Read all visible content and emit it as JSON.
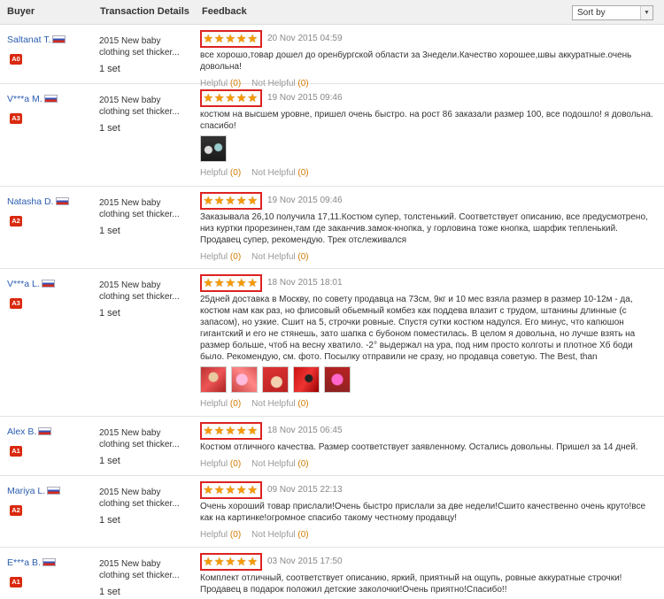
{
  "header": {
    "buyer": "Buyer",
    "transaction": "Transaction Details",
    "feedback": "Feedback",
    "sort_label": "Sort by"
  },
  "helpful_label": "Helpful",
  "not_helpful_label": "Not Helpful",
  "rows": [
    {
      "buyer": "Saltanat T.",
      "level": "A0",
      "product": "2015 New baby clothing set thicker...",
      "qty": "1 set",
      "date": "20 Nov 2015 04:59",
      "text": "все хорошо,товар дошел до оренбургской области за 3недели.Качество хорошее,швы аккуратные.очень довольна!",
      "helpful": "(0)",
      "not_helpful": "(0)",
      "rating": 5
    },
    {
      "buyer": "V***a M.",
      "level": "A3",
      "product": "2015 New baby clothing set thicker...",
      "qty": "1 set",
      "date": "19 Nov 2015 09:46",
      "text": "костюм на высшем уровне, пришел очень быстро. на рост 86 заказали размер 100, все подошло! я довольна. спасибо!",
      "helpful": "(0)",
      "not_helpful": "(0)",
      "rating": 5,
      "photo_count": 1
    },
    {
      "buyer": "Natasha D.",
      "level": "A2",
      "product": "2015 New baby clothing set thicker...",
      "qty": "1 set",
      "date": "19 Nov 2015 09:46",
      "text": "Заказывала 26,10 получила 17,11.Костюм супер, толстенький. Соответствует описанию, все предусмотрено, низ куртки прорезинен,там где заканчив.замок-кнопка, у горловина тоже кнопка, шарфик тепленький. Продавец супер, рекомендую. Трек отслеживался",
      "helpful": "(0)",
      "not_helpful": "(0)",
      "rating": 5
    },
    {
      "buyer": "V***a L.",
      "level": "A3",
      "product": "2015 New baby clothing set thicker...",
      "qty": "1 set",
      "date": "18 Nov 2015 18:01",
      "text": "25дней доставка в Москву, по совету продавца на 73см, 9кг и 10 мес взяла размер в размер 10-12м - да, костюм нам как раз, но флисовый обьемный комбез как поддева влазит с трудом, штанины длинные (с запасом), но узкие. Сшит на 5, строчки ровные. Спустя сутки костюм надулся. Его минус, что капюшон гигантский и его не стянешь, зато шапка с бубоном поместилась. В целом я довольна, но лучше взять на размер больше, чтоб на весну хватило. -2° выдержал на ура, под ним просто колготы и плотное Хб боди было. Рекомендую, см. фото. Посылку отправили не сразу, но продавца советую. The Best, than",
      "helpful": "(0)",
      "not_helpful": "(0)",
      "rating": 5,
      "photo_count": 5
    },
    {
      "buyer": "Alex B.",
      "level": "A1",
      "product": "2015 New baby clothing set thicker...",
      "qty": "1 set",
      "date": "18 Nov 2015 06:45",
      "text": "Костюм отличного качества. Размер соответствует заявленному. Остались довольны. Пришел за 14 дней.",
      "helpful": "(0)",
      "not_helpful": "(0)",
      "rating": 5
    },
    {
      "buyer": "Mariya L.",
      "level": "A2",
      "product": "2015 New baby clothing set thicker...",
      "qty": "1 set",
      "date": "09 Nov 2015 22:13",
      "text": "Очень хороший товар прислали!Очень быстро прислали за две недели!Сшито качественно очень круто!все как на картинке!огромное спасибо такому честному продавцу!",
      "helpful": "(0)",
      "not_helpful": "(0)",
      "rating": 5
    },
    {
      "buyer": "E***a B.",
      "level": "A1",
      "product": "2015 New baby clothing set thicker...",
      "qty": "1 set",
      "date": "03 Nov 2015 17:50",
      "text": "Комплект отличный, соответствует описанию, яркий, приятный на ощупь, ровные аккуратные строчки!Продавец в подарок положил детские заколочки!Очень приятно!Спасибо!!",
      "helpful": "(0)",
      "not_helpful": "(0)",
      "rating": 5
    }
  ]
}
